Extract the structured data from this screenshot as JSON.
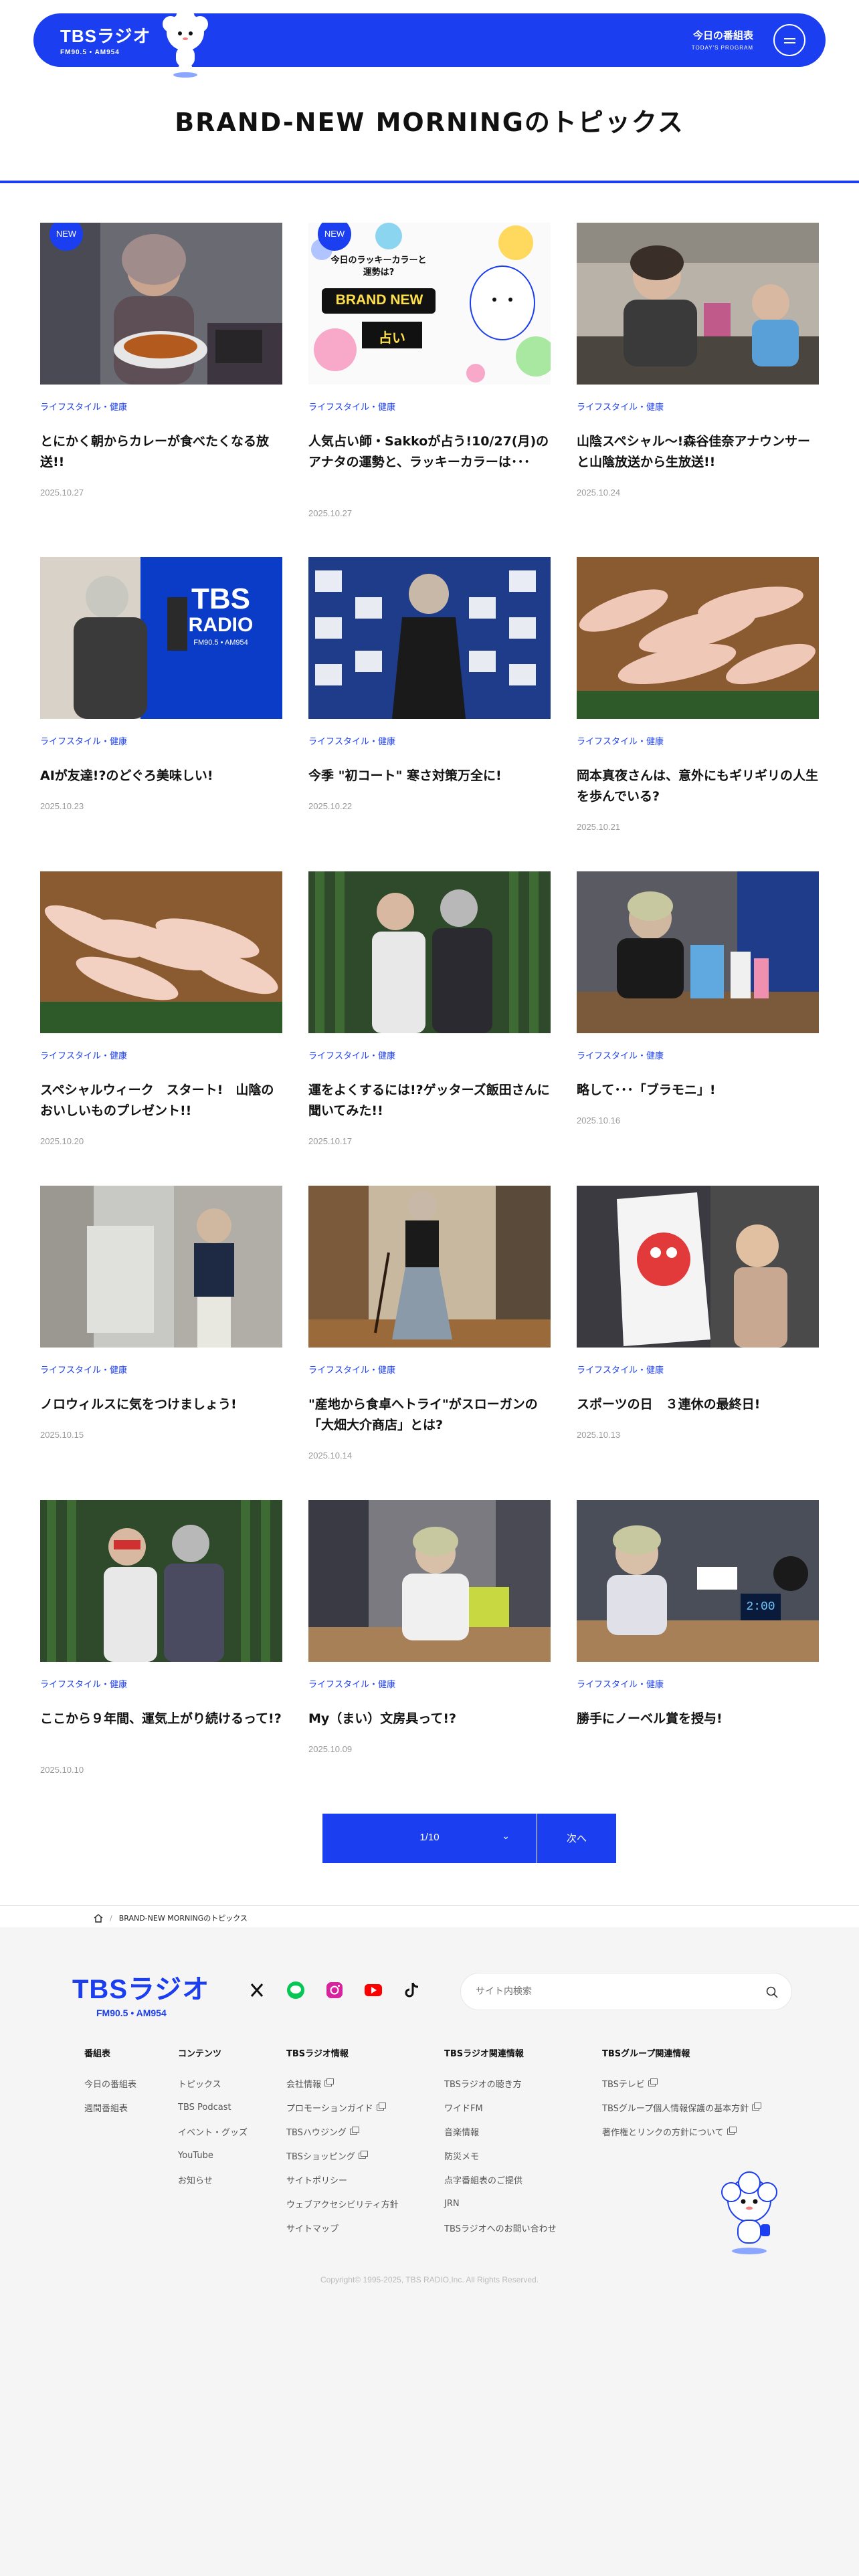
{
  "header": {
    "logo_main": "TBSラジオ",
    "logo_sub": "FM90.5 • AM954",
    "program_label": "今日の番組表",
    "program_label_en": "TODAY'S PROGRAM",
    "accent_color": "#1b3ef0"
  },
  "page_title": "BRAND-NEW MORNINGのトピックス",
  "articles": [
    {
      "category": "ライフスタイル・健康",
      "title": "とにかく朝からカレーが食べたくなる放送!!",
      "date": "2025.10.27",
      "badge": "NEW"
    },
    {
      "category": "ライフスタイル・健康",
      "title": "人気占い師・Sakkoが占う!10/27(月)のアナタの運勢と、ラッキーカラーは･･･",
      "date": "2025.10.27",
      "badge": "NEW",
      "image_text": [
        "今日のラッキーカラーと",
        "運勢は?",
        "BRAND NEW",
        "占い"
      ]
    },
    {
      "category": "ライフスタイル・健康",
      "title": "山陰スペシャル〜!森谷佳奈アナウンサーと山陰放送から生放送!!",
      "date": "2025.10.24"
    },
    {
      "category": "ライフスタイル・健康",
      "title": "AIが友達!?のどぐろ美味しい!",
      "date": "2025.10.23",
      "image_text": [
        "TBS",
        "RADIO",
        "FM90.5 • AM954"
      ]
    },
    {
      "category": "ライフスタイル・健康",
      "title": "今季 \"初コート\" 寒さ対策万全に!",
      "date": "2025.10.22"
    },
    {
      "category": "ライフスタイル・健康",
      "title": "岡本真夜さんは、意外にもギリギリの人生を歩んでいる?",
      "date": "2025.10.21"
    },
    {
      "category": "ライフスタイル・健康",
      "title": "スペシャルウィーク　スタート!　山陰のおいしいものプレゼント!!",
      "date": "2025.10.20"
    },
    {
      "category": "ライフスタイル・健康",
      "title": "運をよくするには!?ゲッターズ飯田さんに聞いてみた!!",
      "date": "2025.10.17"
    },
    {
      "category": "ライフスタイル・健康",
      "title": "略して･･･「ブラモニ」!",
      "date": "2025.10.16"
    },
    {
      "category": "ライフスタイル・健康",
      "title": "ノロウィルスに気をつけましょう!",
      "date": "2025.10.15"
    },
    {
      "category": "ライフスタイル・健康",
      "title": "\"産地から食卓へトライ\"がスローガンの「大畑大介商店」とは?",
      "date": "2025.10.14"
    },
    {
      "category": "ライフスタイル・健康",
      "title": "スポーツの日　３連休の最終日!",
      "date": "2025.10.13"
    },
    {
      "category": "ライフスタイル・健康",
      "title": "ここから９年間、運気上がり続けるって!?",
      "date": "2025.10.10"
    },
    {
      "category": "ライフスタイル・健康",
      "title": "My（まい）文房具って!?",
      "date": "2025.10.09"
    },
    {
      "category": "ライフスタイル・健康",
      "title": "勝手にノーベル賞を授与!",
      "date": "2025.10.08",
      "image_text": [
        "2:00"
      ]
    }
  ],
  "pagination": {
    "current": "1/10",
    "next_label": "次へ"
  },
  "breadcrumb": {
    "current": "BRAND-NEW MORNINGのトピックス"
  },
  "footer": {
    "logo_main": "TBSラジオ",
    "logo_sub": "FM90.5 • AM954",
    "search_placeholder": "サイト内検索",
    "social_icons": [
      "x-icon",
      "line-icon",
      "instagram-icon",
      "youtube-icon",
      "tiktok-icon"
    ],
    "columns": [
      {
        "head": "番組表",
        "items": [
          {
            "label": "今日の番組表"
          },
          {
            "label": "週間番組表"
          }
        ]
      },
      {
        "head": "コンテンツ",
        "items": [
          {
            "label": "トピックス"
          },
          {
            "label": "TBS Podcast"
          },
          {
            "label": "イベント・グッズ"
          },
          {
            "label": "YouTube"
          },
          {
            "label": "お知らせ"
          }
        ]
      },
      {
        "head": "TBSラジオ情報",
        "items": [
          {
            "label": "会社情報",
            "ext": true
          },
          {
            "label": "プロモーションガイド",
            "ext": true
          },
          {
            "label": "TBSハウジング",
            "ext": true
          },
          {
            "label": "TBSショッピング",
            "ext": true
          },
          {
            "label": "サイトポリシー"
          },
          {
            "label": "ウェブアクセシビリティ方針"
          },
          {
            "label": "サイトマップ"
          }
        ]
      },
      {
        "head": "TBSラジオ関連情報",
        "items": [
          {
            "label": "TBSラジオの聴き方"
          },
          {
            "label": "ワイドFM"
          },
          {
            "label": "音楽情報"
          },
          {
            "label": "防災メモ"
          },
          {
            "label": "点字番組表のご提供"
          },
          {
            "label": "JRN"
          },
          {
            "label": "TBSラジオへのお問い合わせ"
          }
        ]
      },
      {
        "head": "TBSグループ関連情報",
        "items": [
          {
            "label": "TBSテレビ",
            "ext": true
          },
          {
            "label": "TBSグループ個人情報保護の基本方針",
            "ext": true
          },
          {
            "label": "著作権とリンクの方針について",
            "ext": true
          }
        ]
      }
    ],
    "copyright": "Copyright© 1995-2025, TBS RADIO,Inc. All Rights Reserved."
  }
}
